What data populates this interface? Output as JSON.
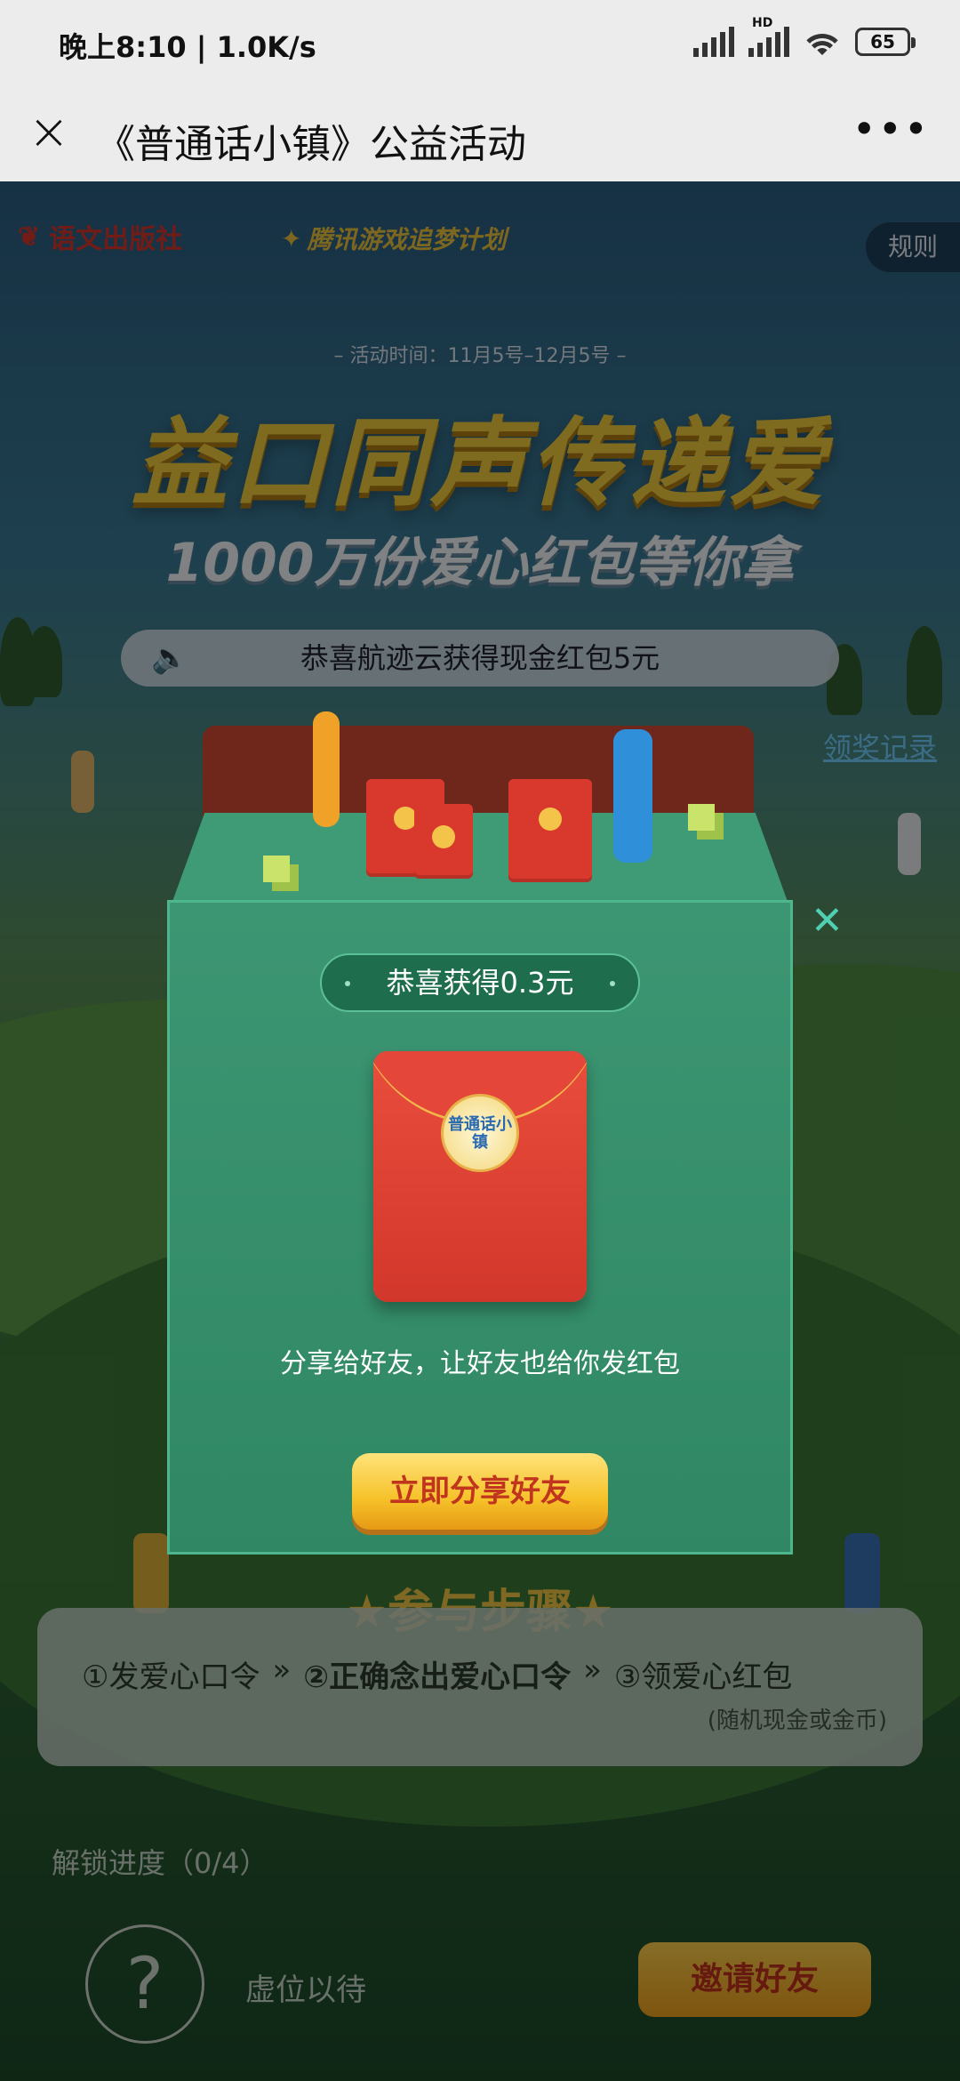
{
  "status_bar": {
    "time": "晚上8:10 | 1.0K/s",
    "hd_label": "HD",
    "battery": "65"
  },
  "titlebar": {
    "title": "《普通话小镇》公益活动",
    "close_icon": "close-icon",
    "more_icon": "more-icon"
  },
  "header": {
    "logo_publisher": "语文出版社",
    "logo_tencent": "腾讯游戏追梦计划",
    "rules": "规则"
  },
  "hero": {
    "activity_time": "– 活动时间：11月5号–12月5号 –",
    "headline": "益口同声传递爱",
    "subheadline": "1000万份爱心红包等你拿"
  },
  "marquee": {
    "icon": "speaker-icon",
    "text": "恭喜航迹云获得现金红包5元"
  },
  "award_record": "领奖记录",
  "popup": {
    "badge": "恭喜获得0.3元",
    "seal_text": "普通话小镇",
    "share_text": "分享给好友，让好友也给你发红包",
    "share_button": "立即分享好友",
    "close_icon": "close-icon"
  },
  "steps": {
    "title": "★参与步骤★",
    "items": [
      "①发爱心口令",
      "»",
      "②正确念出爱心口令",
      "»",
      "③领爱心红包"
    ],
    "note": "(随机现金或金币)"
  },
  "progress": {
    "label": "解锁进度（0/4）",
    "slot_placeholder": "?",
    "waiting": "虚位以待",
    "invite_button": "邀请好友"
  },
  "colors": {
    "accent_gold": "#f3cd3f",
    "popup_green": "#3d9673",
    "envelope_red": "#e94d3c"
  }
}
